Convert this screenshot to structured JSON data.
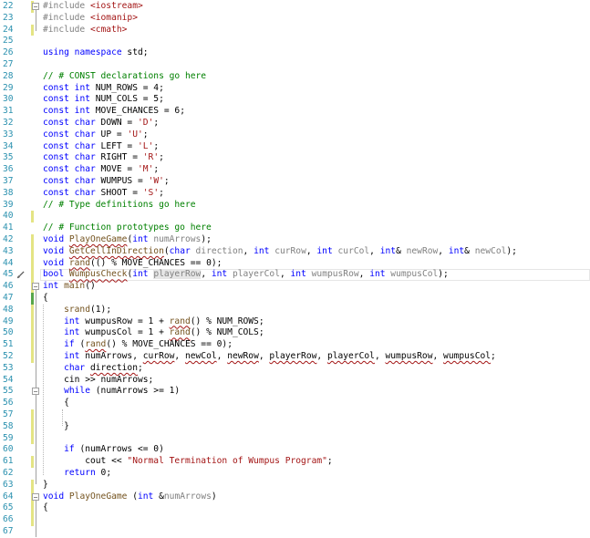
{
  "editor": {
    "first_line_number": 22,
    "lines": [
      {
        "n": "22",
        "parts": [
          [
            "pp",
            "#include "
          ],
          [
            "inc",
            "<iostream>"
          ]
        ]
      },
      {
        "n": "23",
        "parts": [
          [
            "pp",
            "#include "
          ],
          [
            "inc",
            "<iomanip>"
          ]
        ]
      },
      {
        "n": "24",
        "parts": [
          [
            "pp",
            "#include "
          ],
          [
            "inc",
            "<cmath>"
          ]
        ]
      },
      {
        "n": "25",
        "parts": []
      },
      {
        "n": "26",
        "parts": [
          [
            "kw",
            "using"
          ],
          [
            "t",
            " "
          ],
          [
            "kw",
            "namespace"
          ],
          [
            "t",
            " std;"
          ]
        ]
      },
      {
        "n": "27",
        "parts": []
      },
      {
        "n": "28",
        "parts": [
          [
            "cm",
            "// # CONST declarations go here"
          ]
        ]
      },
      {
        "n": "29",
        "parts": [
          [
            "kw",
            "const"
          ],
          [
            "t",
            " "
          ],
          [
            "kw",
            "int"
          ],
          [
            "t",
            " NUM_ROWS = 4;"
          ]
        ]
      },
      {
        "n": "30",
        "parts": [
          [
            "kw",
            "const"
          ],
          [
            "t",
            " "
          ],
          [
            "kw",
            "int"
          ],
          [
            "t",
            " NUM_COLS = 5;"
          ]
        ]
      },
      {
        "n": "31",
        "parts": [
          [
            "kw",
            "const"
          ],
          [
            "t",
            " "
          ],
          [
            "kw",
            "int"
          ],
          [
            "t",
            " MOVE_CHANCES = 6;"
          ]
        ]
      },
      {
        "n": "32",
        "parts": [
          [
            "kw",
            "const"
          ],
          [
            "t",
            " "
          ],
          [
            "kw",
            "char"
          ],
          [
            "t",
            " DOWN = "
          ],
          [
            "str",
            "'D'"
          ],
          [
            "t",
            ";"
          ]
        ]
      },
      {
        "n": "33",
        "parts": [
          [
            "kw",
            "const"
          ],
          [
            "t",
            " "
          ],
          [
            "kw",
            "char"
          ],
          [
            "t",
            " UP = "
          ],
          [
            "str",
            "'U'"
          ],
          [
            "t",
            ";"
          ]
        ]
      },
      {
        "n": "34",
        "parts": [
          [
            "kw",
            "const"
          ],
          [
            "t",
            " "
          ],
          [
            "kw",
            "char"
          ],
          [
            "t",
            " LEFT = "
          ],
          [
            "str",
            "'L'"
          ],
          [
            "t",
            ";"
          ]
        ]
      },
      {
        "n": "35",
        "parts": [
          [
            "kw",
            "const"
          ],
          [
            "t",
            " "
          ],
          [
            "kw",
            "char"
          ],
          [
            "t",
            " RIGHT = "
          ],
          [
            "str",
            "'R'"
          ],
          [
            "t",
            ";"
          ]
        ]
      },
      {
        "n": "36",
        "parts": [
          [
            "kw",
            "const"
          ],
          [
            "t",
            " "
          ],
          [
            "kw",
            "char"
          ],
          [
            "t",
            " MOVE = "
          ],
          [
            "str",
            "'M'"
          ],
          [
            "t",
            ";"
          ]
        ]
      },
      {
        "n": "37",
        "parts": [
          [
            "kw",
            "const"
          ],
          [
            "t",
            " "
          ],
          [
            "kw",
            "char"
          ],
          [
            "t",
            " WUMPUS = "
          ],
          [
            "str",
            "'W'"
          ],
          [
            "t",
            ";"
          ]
        ]
      },
      {
        "n": "38",
        "parts": [
          [
            "kw",
            "const"
          ],
          [
            "t",
            " "
          ],
          [
            "kw",
            "char"
          ],
          [
            "t",
            " SHOOT = "
          ],
          [
            "str",
            "'S'"
          ],
          [
            "t",
            ";"
          ]
        ]
      },
      {
        "n": "39",
        "parts": [
          [
            "cm",
            "// # Type definitions go here"
          ]
        ]
      },
      {
        "n": "40",
        "parts": []
      },
      {
        "n": "41",
        "parts": [
          [
            "cm",
            "// # Function prototypes go here"
          ]
        ]
      },
      {
        "n": "42",
        "parts": [
          [
            "kw",
            "void"
          ],
          [
            "t",
            " "
          ],
          [
            "fnsq",
            "PlayOneGame"
          ],
          [
            "t",
            "("
          ],
          [
            "kw",
            "int"
          ],
          [
            "t",
            " "
          ],
          [
            "par",
            "numArrows"
          ],
          [
            "t",
            ");"
          ]
        ]
      },
      {
        "n": "43",
        "parts": [
          [
            "kw",
            "void"
          ],
          [
            "t",
            " "
          ],
          [
            "fnsq",
            "GetCellInDirection"
          ],
          [
            "t",
            "("
          ],
          [
            "kw",
            "char"
          ],
          [
            "t",
            " "
          ],
          [
            "par",
            "direction"
          ],
          [
            "t",
            ", "
          ],
          [
            "kw",
            "int"
          ],
          [
            "t",
            " "
          ],
          [
            "par",
            "curRow"
          ],
          [
            "t",
            ", "
          ],
          [
            "kw",
            "int"
          ],
          [
            "t",
            " "
          ],
          [
            "par",
            "curCol"
          ],
          [
            "t",
            ", "
          ],
          [
            "kw",
            "int"
          ],
          [
            "t",
            "& "
          ],
          [
            "par",
            "newRow"
          ],
          [
            "t",
            ", "
          ],
          [
            "kw",
            "int"
          ],
          [
            "t",
            "& "
          ],
          [
            "par",
            "newCol"
          ],
          [
            "t",
            ");"
          ]
        ]
      },
      {
        "n": "44",
        "parts": [
          [
            "kw",
            "void"
          ],
          [
            "t",
            " "
          ],
          [
            "fnsq",
            "rand"
          ],
          [
            "t",
            "(() % MOVE_CHANCES == 0);"
          ]
        ]
      },
      {
        "n": "45",
        "parts": [
          [
            "kw",
            "bool"
          ],
          [
            "t",
            " "
          ],
          [
            "fnsq",
            "WumpusCheck"
          ],
          [
            "t",
            "("
          ],
          [
            "kw",
            "int"
          ],
          [
            "t",
            " "
          ],
          [
            "parsel",
            "playerRow"
          ],
          [
            "t",
            ", "
          ],
          [
            "kw",
            "int"
          ],
          [
            "t",
            " "
          ],
          [
            "par",
            "playerCol"
          ],
          [
            "t",
            ", "
          ],
          [
            "kw",
            "int"
          ],
          [
            "t",
            " "
          ],
          [
            "par",
            "wumpusRow"
          ],
          [
            "t",
            ", "
          ],
          [
            "kw",
            "int"
          ],
          [
            "t",
            " "
          ],
          [
            "par",
            "wumpusCol"
          ],
          [
            "t",
            ");"
          ]
        ]
      },
      {
        "n": "46",
        "parts": [
          [
            "kw",
            "int"
          ],
          [
            "t",
            " "
          ],
          [
            "fn",
            "main"
          ],
          [
            "t",
            "()"
          ]
        ]
      },
      {
        "n": "47",
        "parts": [
          [
            "t",
            "{"
          ]
        ]
      },
      {
        "n": "48",
        "parts": [
          [
            "t",
            "    "
          ],
          [
            "fn",
            "srand"
          ],
          [
            "t",
            "(1);"
          ]
        ]
      },
      {
        "n": "49",
        "parts": [
          [
            "t",
            "    "
          ],
          [
            "kw",
            "int"
          ],
          [
            "t",
            " wumpusRow = 1 + "
          ],
          [
            "fnsq",
            "rand"
          ],
          [
            "t",
            "() % NUM_ROWS;"
          ]
        ]
      },
      {
        "n": "50",
        "parts": [
          [
            "t",
            "    "
          ],
          [
            "kw",
            "int"
          ],
          [
            "t",
            " wumpusCol = 1 + "
          ],
          [
            "fnsq",
            "rand"
          ],
          [
            "t",
            "() % NUM_COLS;"
          ]
        ]
      },
      {
        "n": "51",
        "parts": [
          [
            "t",
            "    "
          ],
          [
            "kw",
            "if"
          ],
          [
            "t",
            " ("
          ],
          [
            "fnsq",
            "rand"
          ],
          [
            "t",
            "() % MOVE_CHANCES == 0);"
          ]
        ]
      },
      {
        "n": "52",
        "parts": [
          [
            "t",
            "    "
          ],
          [
            "kw",
            "int"
          ],
          [
            "t",
            " numArrows, "
          ],
          [
            "sq",
            "curRow"
          ],
          [
            "t",
            ", "
          ],
          [
            "sq",
            "newCol"
          ],
          [
            "t",
            ", "
          ],
          [
            "sq",
            "newRow"
          ],
          [
            "t",
            ", "
          ],
          [
            "sq",
            "playerRow"
          ],
          [
            "t",
            ", "
          ],
          [
            "sq",
            "playerCol"
          ],
          [
            "t",
            ", "
          ],
          [
            "sq",
            "wumpusRow"
          ],
          [
            "t",
            ", "
          ],
          [
            "sq",
            "wumpusCol"
          ],
          [
            "t",
            ";"
          ]
        ]
      },
      {
        "n": "53",
        "parts": [
          [
            "t",
            "    "
          ],
          [
            "kw",
            "char"
          ],
          [
            "t",
            " "
          ],
          [
            "sq",
            "direction"
          ],
          [
            "t",
            ";"
          ]
        ]
      },
      {
        "n": "54",
        "parts": [
          [
            "t",
            "    cin >> numArrows;"
          ]
        ]
      },
      {
        "n": "55",
        "parts": [
          [
            "t",
            "    "
          ],
          [
            "kw",
            "while"
          ],
          [
            "t",
            " (numArrows >= 1)"
          ]
        ]
      },
      {
        "n": "56",
        "parts": [
          [
            "t",
            "    {"
          ]
        ]
      },
      {
        "n": "57",
        "parts": []
      },
      {
        "n": "58",
        "parts": [
          [
            "t",
            "    }"
          ]
        ]
      },
      {
        "n": "59",
        "parts": []
      },
      {
        "n": "60",
        "parts": [
          [
            "t",
            "    "
          ],
          [
            "kw",
            "if"
          ],
          [
            "t",
            " (numArrows <= 0)"
          ]
        ]
      },
      {
        "n": "61",
        "parts": [
          [
            "t",
            "        cout << "
          ],
          [
            "str",
            "\"Normal Termination of Wumpus Program\""
          ],
          [
            "t",
            ";"
          ]
        ]
      },
      {
        "n": "62",
        "parts": [
          [
            "t",
            "    "
          ],
          [
            "kw",
            "return"
          ],
          [
            "t",
            " 0;"
          ]
        ]
      },
      {
        "n": "63",
        "parts": [
          [
            "t",
            "}"
          ]
        ]
      },
      {
        "n": "64",
        "parts": [
          [
            "kw",
            "void"
          ],
          [
            "t",
            " "
          ],
          [
            "fn",
            "PlayOneGame"
          ],
          [
            "t",
            " ("
          ],
          [
            "kw",
            "int"
          ],
          [
            "t",
            " &"
          ],
          [
            "par",
            "numArrows"
          ],
          [
            "t",
            ")"
          ]
        ]
      },
      {
        "n": "65",
        "parts": [
          [
            "t",
            "{"
          ]
        ]
      },
      {
        "n": "66",
        "parts": []
      },
      {
        "n": "67",
        "parts": []
      }
    ]
  },
  "colors": {
    "keyword": "#0000ff",
    "string": "#a31515",
    "comment": "#008000",
    "line_number": "#2b91af",
    "change_marker_yellow": "#e4e484",
    "change_marker_green": "#57a64a"
  },
  "icons": {
    "quick_action": "paintbrush-icon"
  }
}
